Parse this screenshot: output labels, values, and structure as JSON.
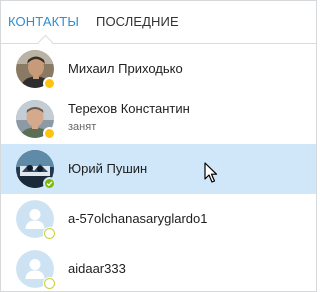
{
  "tabs": {
    "contacts": "КОНТАКТЫ",
    "recent": "ПОСЛЕДНИЕ"
  },
  "contacts": [
    {
      "name": "Михаил Приходько",
      "status": "",
      "presence": "away",
      "avatar": "photo"
    },
    {
      "name": "Терехов Константин",
      "status": "занят",
      "presence": "away",
      "avatar": "photo"
    },
    {
      "name": "Юрий Пушин",
      "status": "",
      "presence": "online",
      "avatar": "photo",
      "selected": true
    },
    {
      "name": "a-57olchanasaryglardo1",
      "status": "",
      "presence": "offline",
      "avatar": "default-person-icon"
    },
    {
      "name": "aidaar333",
      "status": "",
      "presence": "offline",
      "avatar": "default-person-icon"
    }
  ],
  "colors": {
    "accent": "#2b8fd6",
    "selected_row": "#cfe7f9",
    "away": "#ffc20e",
    "online": "#7fba00",
    "offline_ring": "#c7d23a"
  }
}
